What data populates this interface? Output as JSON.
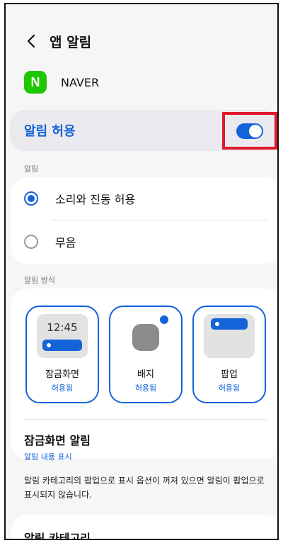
{
  "header": {
    "title": "앱 알림",
    "back_icon": "chevron-left-icon"
  },
  "app": {
    "name": "NAVER",
    "logo_letter": "N",
    "logo_color": "#1ec800"
  },
  "allow": {
    "label": "알림 허용",
    "enabled": true
  },
  "sound_section": {
    "label": "알림",
    "options": [
      {
        "label": "소리와 진동 허용",
        "selected": true
      },
      {
        "label": "무음",
        "selected": false
      }
    ]
  },
  "style_section": {
    "label": "알림 방식",
    "tiles": [
      {
        "name": "잠금화면",
        "status": "허용됨",
        "preview_time": "12:45"
      },
      {
        "name": "배지",
        "status": "허용됨"
      },
      {
        "name": "팝업",
        "status": "허용됨"
      }
    ],
    "lock_alert": {
      "title": "잠금화면 알림",
      "subtitle": "알림 내용 표시"
    }
  },
  "notice": "알림 카테고리의 팝업으로 표시 옵션이 꺼져 있으면 알림이 팝업으로 표시되지 않습니다.",
  "category": {
    "title": "알림 카테고리"
  },
  "colors": {
    "accent": "#1463d9",
    "highlight": "#e0182b",
    "card_bg": "#ffffff",
    "page_bg": "#f6f6f6"
  }
}
